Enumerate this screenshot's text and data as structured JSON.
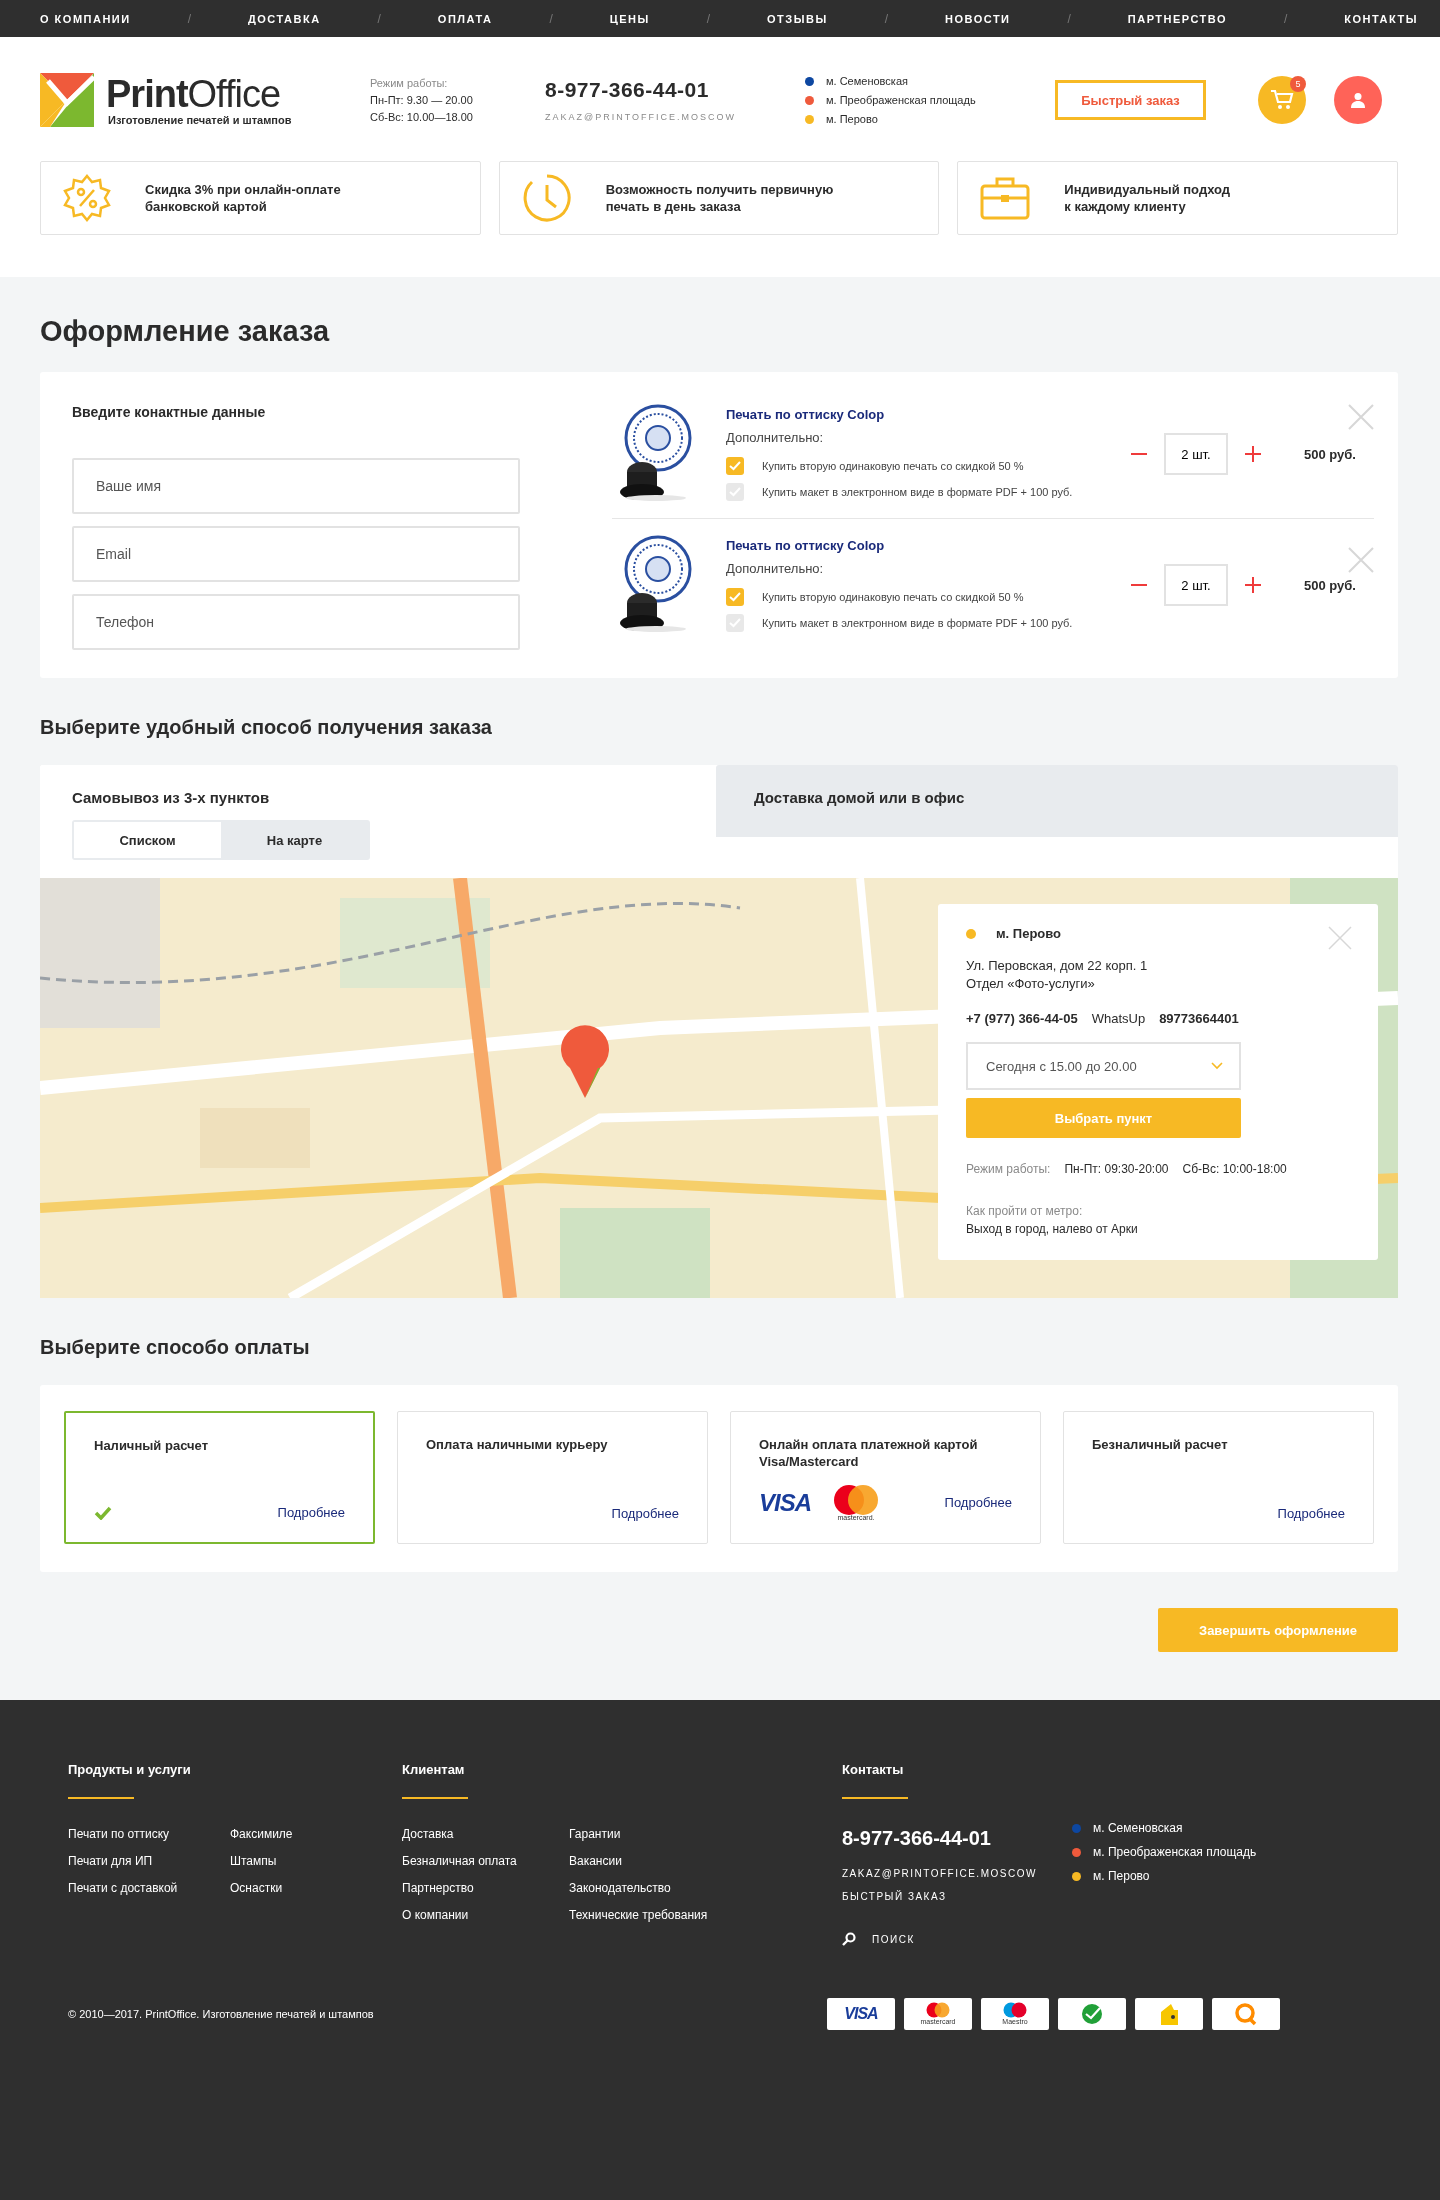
{
  "top_nav": {
    "separator": "/",
    "items": [
      "О КОМПАНИИ",
      "ДОСТАВКА",
      "ОПЛАТА",
      "ЦЕНЫ",
      "ОТЗЫВЫ",
      "НОВОСТИ",
      "ПАРТНЕРСТВО",
      "КОНТАКТЫ"
    ]
  },
  "header": {
    "logo": {
      "name": "**Print**Office",
      "tagline": "Изготовление печатей и штампов"
    },
    "hours": {
      "label": "Режим работы:",
      "lines": [
        "Пн-Пт: 9.30 — 20.00",
        "Сб-Вс: 10.00—18.00"
      ]
    },
    "phone": "8-977-366-44-01",
    "email": "ZAKAZ@PRINTOFFICE.MOSCOW",
    "stations": [
      {
        "name": "м. Семеновская",
        "color": "#0d47a1"
      },
      {
        "name": "м. Преображенская площадь",
        "color": "#ef5a3c"
      },
      {
        "name": "м. Перово",
        "color": "#f7b924"
      }
    ],
    "quick_order": "Быстрый заказ",
    "cart_count": "5"
  },
  "features": [
    {
      "kind": "discount",
      "text": "Скидка 3% при онлайн-оплате\nбанковской картой"
    },
    {
      "kind": "clock",
      "text": "Возможность получить первичную\nпечать в день заказа"
    },
    {
      "kind": "briefcase",
      "text": "Индивидуальный подход\nк каждому клиенту"
    }
  ],
  "page_title": "Оформление заказа",
  "contacts": {
    "heading": "Введите конактные данные",
    "fields": [
      {
        "placeholder": "Ваше имя"
      },
      {
        "placeholder": "Email"
      },
      {
        "placeholder": "Телефон"
      }
    ]
  },
  "cart_items": [
    {
      "title": "Печать по оттиску Colop",
      "extra_label": "Дополнительно:",
      "options": [
        {
          "label": "Купить вторую одинаковую печать со скидкой 50 %",
          "checked": true
        },
        {
          "label": "Купить макет в электронном виде в формате PDF + 100 руб.",
          "checked": false
        }
      ],
      "quantity": "2 шт.",
      "price": "500 руб."
    },
    {
      "title": "Печать по оттиску Colop",
      "extra_label": "Дополнительно:",
      "options": [
        {
          "label": "Купить вторую одинаковую печать со скидкой 50 %",
          "checked": true
        },
        {
          "label": "Купить макет в электронном виде в формате PDF + 100 руб.",
          "checked": false
        }
      ],
      "quantity": "2 шт.",
      "price": "500 руб."
    }
  ],
  "delivery": {
    "heading": "Выберите удобный способ получения заказа",
    "tabs": [
      {
        "label": "Самовывоз из 3-х пунктов",
        "selected": true
      },
      {
        "label": "Доставка домой или в офис",
        "selected": false
      }
    ],
    "view_toggle": [
      {
        "label": "Списком",
        "selected": true
      },
      {
        "label": "На карте",
        "selected": false
      }
    ],
    "popup": {
      "station": "м. Перово",
      "color": "#f7b924",
      "address": [
        "Ул. Перовская, дом 22 корп. 1",
        "Отдел «Фото-услуги»"
      ],
      "phone": "+7 (977) 366-44-05",
      "whatsapp_label": "WhatsUp",
      "whatsapp": "89773664401",
      "time_select": "Сегодня с 15.00 до 20.00",
      "button": "Выбрать пункт",
      "hours_label": "Режим работы:",
      "hours": [
        "Пн-Пт: 09:30-20:00",
        "Сб-Вс: 10:00-18:00"
      ],
      "directions_label": "Как пройти от метро:",
      "directions": "Выход в город, налево от Арки"
    }
  },
  "payment": {
    "heading": "Выберите способо оплаты",
    "options": [
      {
        "title": "Наличный расчет",
        "selected": true,
        "more": "Подробнее"
      },
      {
        "title": "Оплата наличными курьеру",
        "selected": false,
        "more": "Подробнее"
      },
      {
        "title": "Онлайн оплата платежной картой Visa/Mastercard",
        "selected": false,
        "more": "Подробнее",
        "logos": [
          {
            "kind": "visa",
            "text": "VISA"
          },
          {
            "kind": "mastercard",
            "text": "mastercard."
          }
        ]
      },
      {
        "title": "Безналичный расчет",
        "selected": false,
        "more": "Подробнее"
      }
    ],
    "submit": "Завершить оформление"
  },
  "footer": {
    "products": {
      "heading": "Продукты и услуги",
      "columns": [
        [
          "Печати по оттиску",
          "Печати для ИП",
          "Печати с доставкой"
        ],
        [
          "Факсимиле",
          "Штампы",
          "Оснастки"
        ]
      ]
    },
    "clients": {
      "heading": "Клиентам",
      "columns": [
        [
          "Доставка",
          "Безналичная оплата",
          "Партнерство",
          "О компании"
        ],
        [
          "Гарантии",
          "Вакансии",
          "Законодательство",
          "Технические требования"
        ]
      ]
    },
    "contacts": {
      "heading": "Контакты",
      "phone": "8-977-366-44-01",
      "email": "ZAKAZ@PRINTOFFICE.MOSCOW",
      "quick_order": "БЫСТРЫЙ ЗАКАЗ",
      "search": "ПОИСК",
      "stations": [
        {
          "name": "м. Семеновская",
          "color": "#0d47a1"
        },
        {
          "name": "м. Преображенская площадь",
          "color": "#ef5a3c"
        },
        {
          "name": "м. Перово",
          "color": "#f7b924"
        }
      ]
    },
    "copyright": "© 2010—2017. PrintOffice. Изготовление печатей и штампов",
    "badges": [
      {
        "kind": "visa",
        "text": "VISA"
      },
      {
        "kind": "mastercard",
        "text": "mastercard"
      },
      {
        "kind": "maestro",
        "text": "Maestro"
      },
      {
        "kind": "sber"
      },
      {
        "kind": "yandex"
      },
      {
        "kind": "qiwi"
      }
    ]
  }
}
